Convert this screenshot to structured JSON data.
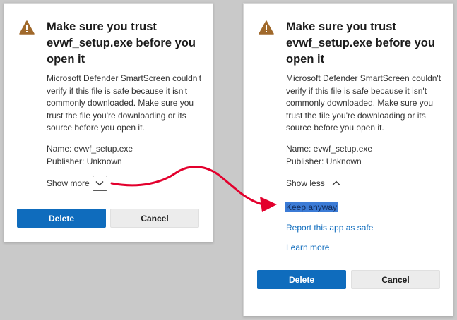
{
  "colors": {
    "accent": "#0f6cbd",
    "warning_icon": "#a0692b",
    "annotation_arrow": "#e3002d",
    "selection_highlight": "#3b7bd6"
  },
  "icons": {
    "warning": "warning-triangle-icon",
    "chevron_down": "chevron-down-icon",
    "chevron_up": "chevron-up-icon"
  },
  "left_dialog": {
    "title": "Make sure you trust evwf_setup.exe before you open it",
    "description": "Microsoft Defender SmartScreen couldn't verify if this file is safe because it isn't commonly downloaded. Make sure you trust the file you're downloading or its source before you open it.",
    "name_line": "Name: evwf_setup.exe",
    "publisher_line": "Publisher: Unknown",
    "toggle_label": "Show more",
    "delete_label": "Delete",
    "cancel_label": "Cancel"
  },
  "right_dialog": {
    "title": "Make sure you trust evwf_setup.exe before you open it",
    "description": "Microsoft Defender SmartScreen couldn't verify if this file is safe because it isn't commonly downloaded. Make sure you trust the file you're downloading or its source before you open it.",
    "name_line": "Name: evwf_setup.exe",
    "publisher_line": "Publisher: Unknown",
    "toggle_label": "Show less",
    "keep_anyway_label": "Keep anyway",
    "report_safe_label": "Report this app as safe",
    "learn_more_label": "Learn more",
    "delete_label": "Delete",
    "cancel_label": "Cancel"
  }
}
